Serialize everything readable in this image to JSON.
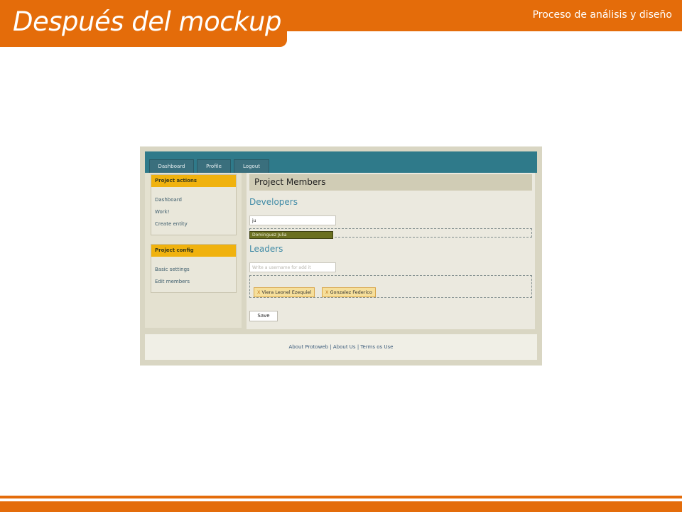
{
  "slide": {
    "title": "Después del mockup",
    "subtitle": "Proceso de análisis y diseño"
  },
  "app": {
    "nav": {
      "tabs": [
        "Dashboard",
        "Profile",
        "Logout"
      ]
    },
    "sidebar": {
      "project_actions": {
        "title": "Project actions",
        "items": [
          "Dashboard",
          "Work!",
          "Create entity"
        ]
      },
      "project_config": {
        "title": "Project config",
        "items": [
          "Basic settings",
          "Edit members"
        ]
      }
    },
    "main": {
      "header": "Project Members",
      "developers": {
        "title": "Developers",
        "input_value": "ju",
        "suggestion": "Dominguez Julia"
      },
      "leaders": {
        "title": "Leaders",
        "input_placeholder": "Write a username for add it",
        "members": [
          "Viera Leonel Ezequiel",
          "Gonzalez Federico"
        ],
        "remove_glyph": "X"
      },
      "save_label": "Save"
    },
    "footer": {
      "links": [
        "About Protoweb",
        "About Us",
        "Terms os Use"
      ],
      "separator": "|"
    }
  },
  "colors": {
    "slide_accent": "#e46c0a",
    "nav_bar": "#2f7a8a",
    "box_header": "#f0b20e",
    "section_title": "#3f8aa6",
    "suggestion_bg": "#6b7020",
    "chip_bg": "#f6df9b"
  }
}
